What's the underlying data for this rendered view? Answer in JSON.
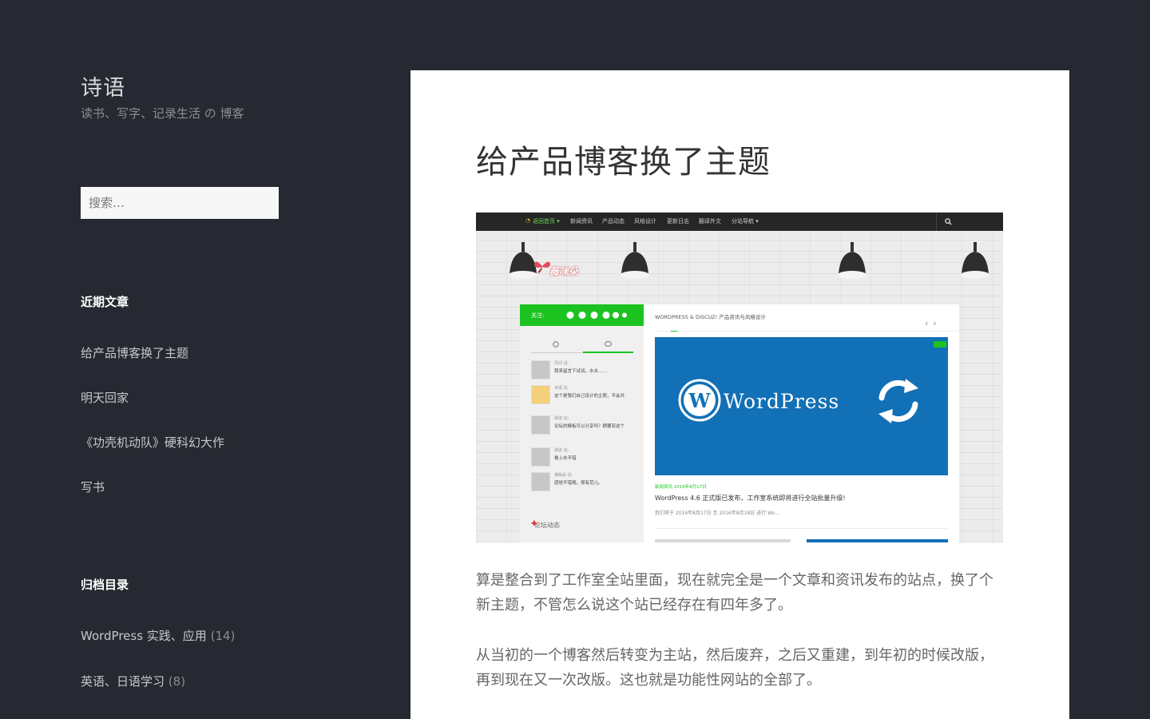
{
  "site": {
    "title": "诗语",
    "description": "读书、写字、记录生活 の 博客"
  },
  "search": {
    "placeholder": "搜索…"
  },
  "recent_posts": {
    "title": "近期文章",
    "items": [
      "给产品博客换了主题",
      "明天回家",
      "《功壳机动队》硬科幻大作",
      "写书"
    ]
  },
  "archives": {
    "title": "归档目录",
    "items": [
      {
        "label": "WordPress 实践、应用",
        "count": "(14)"
      },
      {
        "label": "英语、日语学习",
        "count": "(8)"
      }
    ]
  },
  "post": {
    "title": "给产品博客换了主题",
    "paragraphs": [
      "算是整合到了工作室全站里面，现在就完全是一个文章和资讯发布的站点，换了个新主题，不管怎么说这个站已经存在有四年多了。",
      "从当初的一个博客然后转变为主站，然后废弃，之后又重建，到年初的时候改版，再到现在又一次改版。这也就是功能性网站的全部了。"
    ]
  },
  "featured_image": {
    "nav": [
      "返回首页 ▾",
      "新闻资讯",
      "产品动态",
      "风格设计",
      "更新日志",
      "翻译外文",
      "分站导航 ▾"
    ],
    "logo": "薇咪朵",
    "follow_label": "关注:",
    "comments": [
      {
        "name": "风间 说:",
        "text": "我来留言下试试。水水……",
        "photo": false
      },
      {
        "name": "诗语 说:",
        "text": "这个是我们自己设计的主题，不会共",
        "photo": true
      },
      {
        "name": "歌歌 说:",
        "text": "论坛的模板可以分享吗？摘要双这个",
        "photo": false
      },
      {
        "name": "歌歌 说:",
        "text": "看上去不错",
        "photo": false
      },
      {
        "name": "潘翰朵 说:",
        "text": "感觉不错哦，很有范儿。",
        "photo": false
      }
    ],
    "forum_label": "论坛动态",
    "breadcrumb": "WORDPRESS & DISCUZ! 产品资讯与风格设计",
    "banner_text": "WordPress",
    "meta": "新闻资讯  2016年8月17日",
    "headline": "WordPress 4.6 正式版已发布，工作室系统即将进行全站批量升级!",
    "excerpt": "我们将于 2016年8月17日 至 2016年8月18日 进行 Wo…",
    "colors": {
      "green": "#1cc320",
      "wp_blue": "#1270b6",
      "nav_bg": "#262626"
    }
  },
  "colors": {
    "page_bg": "#262931",
    "panel_bg": "#ffffff",
    "heading_text": "#333333",
    "body_text": "#666666"
  }
}
